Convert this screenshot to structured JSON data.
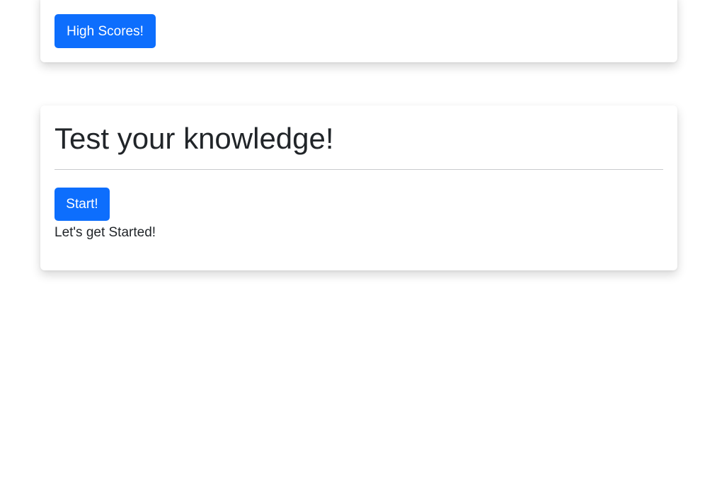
{
  "high_scores_card": {
    "button_label": "High Scores!"
  },
  "quiz_card": {
    "title": "Test your knowledge!",
    "start_button_label": "Start!",
    "status_text": "Let's get Started!"
  },
  "colors": {
    "primary": "#0d6efd",
    "text": "#212529",
    "divider": "#c9cbcd"
  }
}
